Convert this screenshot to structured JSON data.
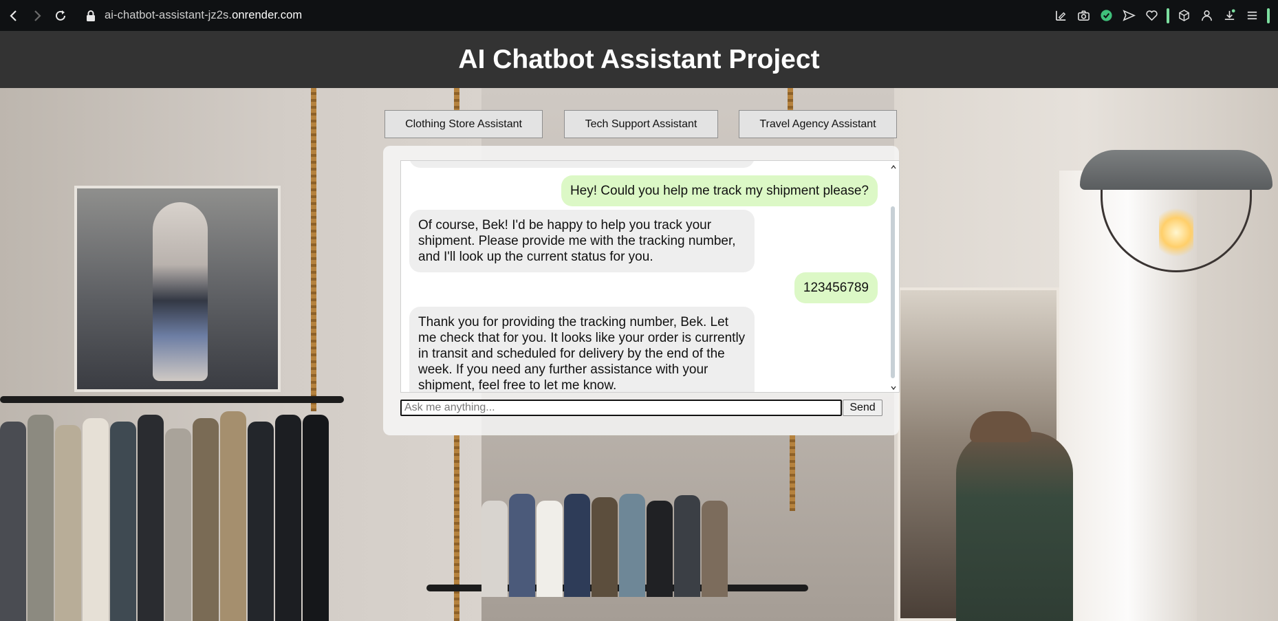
{
  "browser": {
    "url_prefix": "ai-chatbot-assistant-jz2s.",
    "url_host": "onrender.com"
  },
  "header": {
    "title": "AI Chatbot Assistant Project"
  },
  "assistants": [
    {
      "label": "Clothing Store Assistant"
    },
    {
      "label": "Tech Support Assistant"
    },
    {
      "label": "Travel Agency Assistant"
    }
  ],
  "chat": {
    "messages": [
      {
        "role": "user",
        "text": "Hey! Could you help me track my shipment please?"
      },
      {
        "role": "bot",
        "text": "Of course, Bek! I'd be happy to help you track your shipment. Please provide me with the tracking number, and I'll look up the current status for you."
      },
      {
        "role": "user",
        "text": "123456789"
      },
      {
        "role": "bot",
        "text": "Thank you for providing the tracking number, Bek. Let me check that for you. It looks like your order is currently in transit and scheduled for delivery by the end of the week. If you need any further assistance with your shipment, feel free to let me know."
      }
    ],
    "input_placeholder": "Ask me anything...",
    "input_value": "",
    "send_label": "Send"
  },
  "colors": {
    "header_bg": "#333333",
    "user_bubble": "#dcf8c6",
    "bot_bubble": "#eeeeee",
    "browser_bar": "#0f1113"
  }
}
